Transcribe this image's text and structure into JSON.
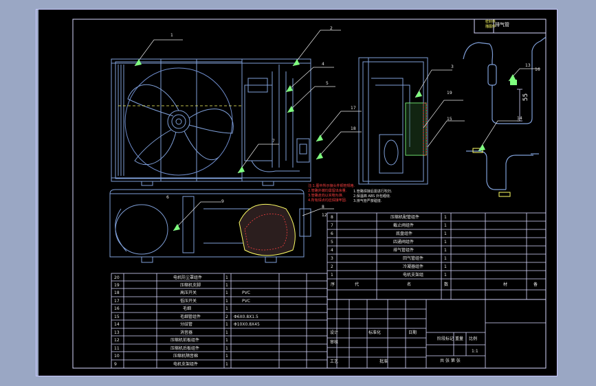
{
  "title_box": {
    "line1": "密封件",
    "line2": "描图件"
  },
  "exhaust_pipe_title": "排气管",
  "callouts": {
    "c1": "1",
    "c2": "2",
    "c3": "3",
    "c4": "4",
    "c5": "5",
    "c6": "6",
    "c7": "7",
    "c8": "8",
    "c9": "9",
    "c12": "12",
    "c13": "13",
    "c14": "14",
    "c15": "15",
    "c16": "16",
    "c17": "17",
    "c18": "18",
    "c19": "19"
  },
  "dimension": "55",
  "red_notes": [
    "注:1.图中所示接头件铜管规格.",
    "2.管路外端均需留出余量.",
    "3.管路走向以实物为准.",
    "4.所有焊点均应焊接牢固."
  ],
  "white_notes": [
    "1.管路焊接后需进行吹扫.",
    "2.保温棉 ABS 外包缠绕.",
    "3.排气管严禁碰撞."
  ],
  "right_table": [
    {
      "no": "8",
      "name": "压缩机配管组件",
      "qty": "1"
    },
    {
      "no": "7",
      "name": "截止阀组件",
      "qty": "1"
    },
    {
      "no": "6",
      "name": "底盘组件",
      "qty": "1"
    },
    {
      "no": "5",
      "name": "四通阀组件",
      "qty": "1"
    },
    {
      "no": "4",
      "name": "排气管组件",
      "qty": "1"
    },
    {
      "no": "3",
      "name": "回气管组件",
      "qty": "1"
    },
    {
      "no": "2",
      "name": "冷凝器组件",
      "qty": "1"
    },
    {
      "no": "1",
      "name": "电机支架组",
      "qty": "1"
    }
  ],
  "right_header": [
    "序",
    "代",
    "名",
    "数",
    "材",
    "备"
  ],
  "left_table": [
    {
      "no": "20",
      "name": "电机防尘罩组件",
      "qty": "1",
      "mat": ""
    },
    {
      "no": "19",
      "name": "压缩机支脚",
      "qty": "1",
      "mat": ""
    },
    {
      "no": "18",
      "name": "高压开关",
      "qty": "1",
      "mat": "PVC"
    },
    {
      "no": "17",
      "name": "低压开关",
      "qty": "1",
      "mat": "PVC"
    },
    {
      "no": "16",
      "name": "毛细",
      "qty": "1",
      "mat": ""
    },
    {
      "no": "15",
      "name": "毛细管组件",
      "qty": "2",
      "mat": "Φ6X0.8X1.5"
    },
    {
      "no": "14",
      "name": "分歧管",
      "qty": "1",
      "mat": "Φ10X0.8X45"
    },
    {
      "no": "13",
      "name": "消音器",
      "qty": "1",
      "mat": ""
    },
    {
      "no": "12",
      "name": "压缩机前板组件",
      "qty": "1",
      "mat": ""
    },
    {
      "no": "11",
      "name": "压缩机后板组件",
      "qty": "1",
      "mat": ""
    },
    {
      "no": "10",
      "name": "压缩机隔音棉",
      "qty": "1",
      "mat": ""
    },
    {
      "no": "9",
      "name": "电机支架组件",
      "qty": "1",
      "mat": ""
    }
  ],
  "title_block": {
    "design": "设计",
    "check": "审核",
    "standard": "标准化",
    "approve": "批准",
    "stage": "阶段标记",
    "weight": "重量",
    "scale": "比例",
    "ratio": "1:1",
    "sheet": "共 张 第 张",
    "process": "工艺",
    "date": "日期"
  }
}
